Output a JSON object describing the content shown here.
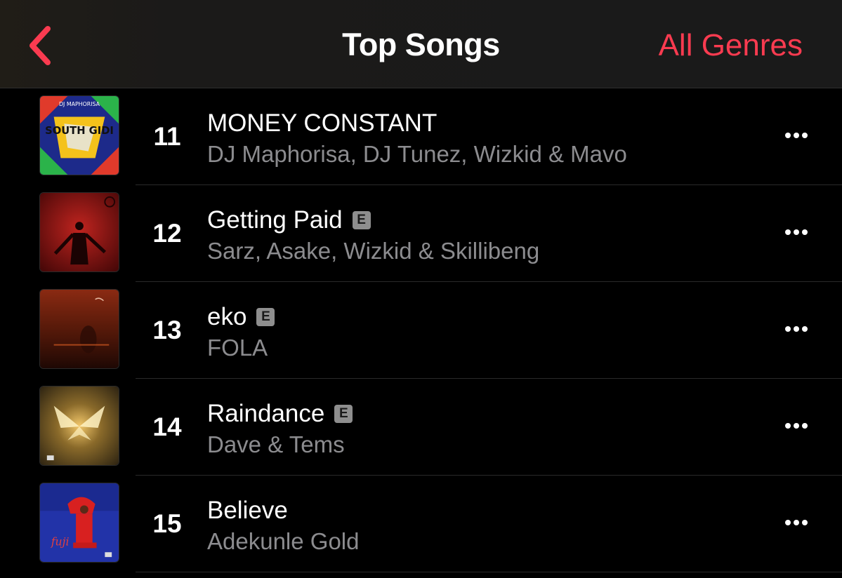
{
  "nav": {
    "title": "Top Songs",
    "genres_label": "All Genres",
    "accent_color": "#fa3b50",
    "back_icon": "chevron-left-icon"
  },
  "songs": [
    {
      "rank": "11",
      "title": "MONEY CONSTANT",
      "artist": "DJ Maphorisa, DJ Tunez, Wizkid & Mavo",
      "explicit": false,
      "explicit_label": ""
    },
    {
      "rank": "12",
      "title": "Getting Paid",
      "artist": "Sarz, Asake, Wizkid & Skillibeng",
      "explicit": true,
      "explicit_label": "E"
    },
    {
      "rank": "13",
      "title": "eko",
      "artist": "FOLA",
      "explicit": true,
      "explicit_label": "E"
    },
    {
      "rank": "14",
      "title": "Raindance",
      "artist": "Dave & Tems",
      "explicit": true,
      "explicit_label": "E"
    },
    {
      "rank": "15",
      "title": "Believe",
      "artist": "Adekunle Gold",
      "explicit": false,
      "explicit_label": ""
    }
  ],
  "artwork": {
    "11": {
      "title_text": "SOUTH GIDI",
      "label_text": "DJ MAPHORISA"
    },
    "15": {
      "title_text": "fuji"
    }
  }
}
